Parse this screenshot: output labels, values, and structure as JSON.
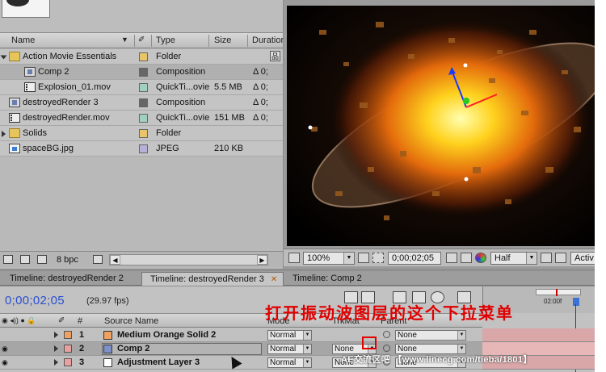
{
  "project": {
    "columns": {
      "name": "Name",
      "type": "Type",
      "size": "Size",
      "duration": "Duration"
    },
    "items": [
      {
        "name": "Action Movie Essentials",
        "icon": "folder-icon",
        "label_color": "#e9c46a",
        "type": "Folder",
        "size": "",
        "duration": ""
      },
      {
        "name": "Comp 2",
        "icon": "composition-icon",
        "label_color": "#666666",
        "type": "Composition",
        "size": "",
        "duration": "Δ 0;"
      },
      {
        "name": "Explosion_01.mov",
        "icon": "movie-file-icon",
        "label_color": "#9fd0c2",
        "type": "QuickTi...ovie",
        "size": "5.5 MB",
        "duration": "Δ 0;"
      },
      {
        "name": "destroyedRender 3",
        "icon": "composition-icon",
        "label_color": "#666666",
        "type": "Composition",
        "size": "",
        "duration": "Δ 0;"
      },
      {
        "name": "destroyedRender.mov",
        "icon": "movie-file-icon",
        "label_color": "#9fd0c2",
        "type": "QuickTi...ovie",
        "size": "151 MB",
        "duration": "Δ 0;"
      },
      {
        "name": "Solids",
        "icon": "folder-icon",
        "label_color": "#e9c46a",
        "type": "Folder",
        "size": "",
        "duration": ""
      },
      {
        "name": "spaceBG.jpg",
        "icon": "image-file-icon",
        "label_color": "#b8b0d8",
        "type": "JPEG",
        "size": "210 KB",
        "duration": ""
      }
    ],
    "footer": {
      "bpc": "8 bpc"
    }
  },
  "viewer": {
    "zoom": "100%",
    "timecode": "0;00;02;05",
    "resolution": "Half",
    "view_label": "Activ"
  },
  "timeline": {
    "tabs": [
      {
        "label": "Timeline: destroyedRender 2",
        "active": false
      },
      {
        "label": "Timeline: destroyedRender 3",
        "active": true
      },
      {
        "label": "Timeline: Comp 2",
        "active": false
      }
    ],
    "timecode": "0;00;02;05",
    "fps": "(29.97 fps)",
    "ruler_label": "02:00f",
    "columns": {
      "num": "#",
      "source_name": "Source Name",
      "mode": "Mode",
      "trkmat": "TrkMat",
      "parent": "Parent"
    },
    "layers": [
      {
        "num": "1",
        "name": "Medium Orange Solid 2",
        "label_color": "#f0a060",
        "type_color": "#f0a060",
        "mode": "Normal",
        "trkmat": "",
        "parent": "None"
      },
      {
        "num": "2",
        "name": "Comp 2",
        "label_color": "#e8a0a0",
        "type_color": "#7e90c8",
        "mode": "Normal",
        "trkmat": "None",
        "parent": "None"
      },
      {
        "num": "3",
        "name": "Adjustment Layer 3",
        "label_color": "#e8a0a0",
        "type_color": "#ffffff",
        "mode": "Normal",
        "trkmat": "None",
        "parent": "None"
      }
    ]
  },
  "annotation": "打开振动波图层的这个下拉菜单",
  "watermark": "AE交流区吧 【www.linecg.com/tieba/1801】"
}
